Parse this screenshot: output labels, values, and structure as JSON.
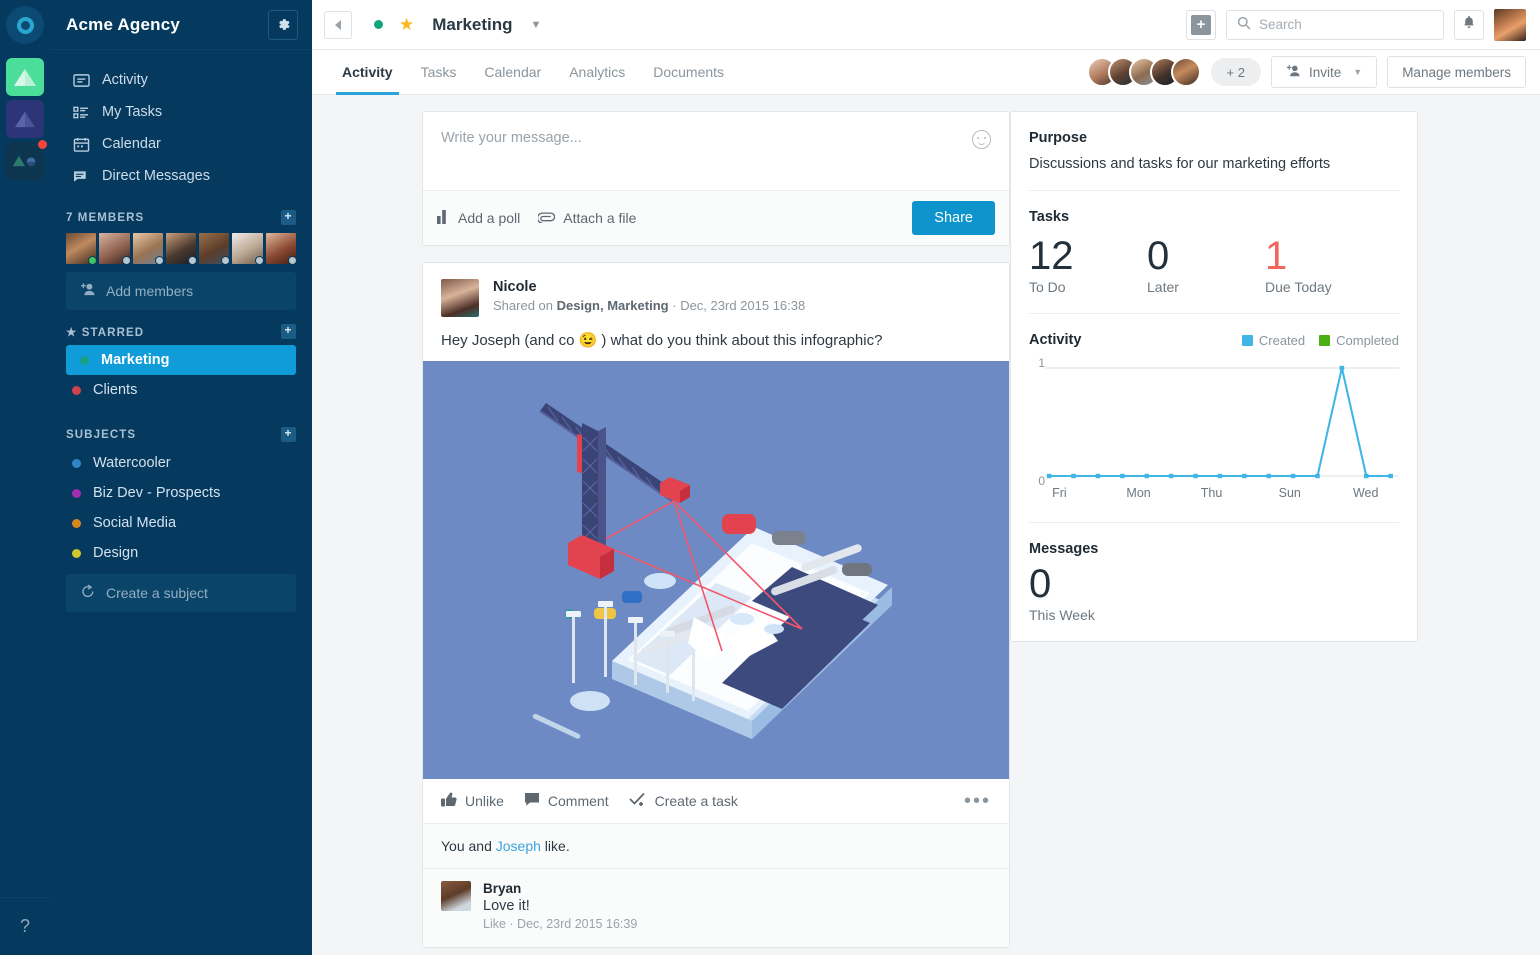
{
  "colors": {
    "sidebar_bg": "#05395e",
    "accent_blue": "#0f9cd8",
    "share_blue": "#0d94cd",
    "tab_underline": "#2aa3dd",
    "star_yellow": "#fcb71b",
    "due_red": "#f2665b",
    "created_blue": "#41b6e6",
    "completed_green": "#4caf12",
    "online_green": "#43c55e"
  },
  "rail": {
    "logo": "circle-logo",
    "apps": [
      {
        "name": "app-tile-green",
        "color": "#4ade9a"
      },
      {
        "name": "app-tile-indigo",
        "color": "#2e3478"
      },
      {
        "name": "app-tile-dark",
        "color": "#0d3550",
        "badge": true
      }
    ],
    "help_label": "?"
  },
  "sidebar": {
    "workspace_title": "Acme Agency",
    "settings_icon": "gear-icon",
    "nav": [
      {
        "label": "Activity",
        "icon": "activity-icon"
      },
      {
        "label": "My Tasks",
        "icon": "tasks-icon"
      },
      {
        "label": "Calendar",
        "icon": "calendar-icon"
      },
      {
        "label": "Direct Messages",
        "icon": "messages-icon"
      }
    ],
    "members_heading": "7 MEMBERS",
    "members_add_icon": "plus-icon",
    "member_count": 7,
    "members": [
      {
        "name": "member-avatar-1",
        "status": "online"
      },
      {
        "name": "member-avatar-2",
        "status": "offline"
      },
      {
        "name": "member-avatar-3",
        "status": "offline"
      },
      {
        "name": "member-avatar-4",
        "status": "offline"
      },
      {
        "name": "member-avatar-5",
        "status": "offline"
      },
      {
        "name": "member-avatar-6",
        "status": "offline"
      },
      {
        "name": "member-avatar-7",
        "status": "offline"
      }
    ],
    "add_members_label": "Add members",
    "starred_heading": "STARRED",
    "starred": [
      {
        "label": "Marketing",
        "color": "#16a085",
        "selected": true
      },
      {
        "label": "Clients",
        "color": "#d0434c",
        "selected": false
      }
    ],
    "subjects_heading": "SUBJECTS",
    "subjects": [
      {
        "label": "Watercooler",
        "color": "#2e86c8"
      },
      {
        "label": "Biz Dev - Prospects",
        "color": "#a12fb0"
      },
      {
        "label": "Social Media",
        "color": "#d9881c"
      },
      {
        "label": "Design",
        "color": "#cfc92c"
      }
    ],
    "create_subject_label": "Create a subject"
  },
  "topbar": {
    "back_icon": "chevron-left-icon",
    "channel_status_dot": "#12a47d",
    "star_icon": "star-icon",
    "channel_name": "Marketing",
    "channel_caret": "chevron-down-icon",
    "add_icon": "plus-icon",
    "search_placeholder": "Search",
    "search_value": "",
    "bell_icon": "bell-icon",
    "user_avatar": "current-user-avatar"
  },
  "tabs": [
    {
      "label": "Activity",
      "active": true
    },
    {
      "label": "Tasks",
      "active": false
    },
    {
      "label": "Calendar",
      "active": false
    },
    {
      "label": "Analytics",
      "active": false
    },
    {
      "label": "Documents",
      "active": false
    }
  ],
  "members_bar": {
    "overflow_label": "+ 2",
    "invite_label": "Invite",
    "invite_caret": "chevron-down-icon",
    "manage_label": "Manage members"
  },
  "composer": {
    "placeholder": "Write your message...",
    "value": "",
    "emoji_icon": "smiley-icon",
    "poll_label": "Add a poll",
    "poll_icon": "bar-chart-icon",
    "attach_label": "Attach a file",
    "attach_icon": "paperclip-icon",
    "share_label": "Share"
  },
  "post": {
    "author": "Nicole",
    "meta_prefix": "Shared on",
    "meta_channels": "Design, Marketing",
    "meta_sep": "·",
    "meta_date": "Dec, 23rd 2015 16:38",
    "body": "Hey Joseph (and co 😉 ) what do you think about this infographic?",
    "image_alt": "isometric-crane-smartphone-illustration",
    "actions": [
      {
        "label": "Unlike",
        "icon": "thumbs-up-icon"
      },
      {
        "label": "Comment",
        "icon": "comment-icon"
      },
      {
        "label": "Create a task",
        "icon": "check-task-icon"
      }
    ],
    "more_icon": "ellipsis-icon",
    "likes_prefix": "You  and ",
    "likes_link": "Joseph",
    "likes_suffix": " like.",
    "comments": [
      {
        "author": "Bryan",
        "body": "Love it!",
        "meta": "Like · Dec, 23rd 2015 16:39"
      }
    ]
  },
  "right_panel": {
    "purpose_heading": "Purpose",
    "purpose_text": "Discussions and tasks for our marketing efforts",
    "tasks_heading": "Tasks",
    "task_stats": [
      {
        "value": "12",
        "label": "To Do",
        "red": false
      },
      {
        "value": "0",
        "label": "Later",
        "red": false
      },
      {
        "value": "1",
        "label": "Due Today",
        "red": true
      }
    ],
    "activity_heading": "Activity",
    "legend": [
      {
        "label": "Created",
        "color": "#41b6e6"
      },
      {
        "label": "Completed",
        "color": "#4caf12"
      }
    ],
    "messages_heading": "Messages",
    "messages_value": "0",
    "messages_label": "This Week"
  },
  "chart_data": {
    "type": "line",
    "title": "Activity",
    "xlabel": "",
    "ylabel": "",
    "ylim": [
      0,
      1
    ],
    "ytick_labels": [
      "0",
      "1"
    ],
    "grid": true,
    "legend_position": "top-right",
    "x": [
      0,
      1,
      2,
      3,
      4,
      5,
      6,
      7,
      8,
      9,
      10,
      11,
      12,
      13
    ],
    "xtick_labels": [
      "Fri",
      "Mon",
      "Thu",
      "Sun",
      "Wed"
    ],
    "xtick_positions": [
      0,
      3,
      6,
      9,
      12
    ],
    "series": [
      {
        "name": "Created",
        "color": "#41b6e6",
        "values": [
          0,
          0,
          0,
          0,
          0,
          0,
          0,
          0,
          0,
          0,
          0,
          0,
          1,
          0,
          0
        ]
      },
      {
        "name": "Completed",
        "color": "#4caf12",
        "values": [
          0,
          0,
          0,
          0,
          0,
          0,
          0,
          0,
          0,
          0,
          0,
          0,
          0,
          0,
          0
        ]
      }
    ]
  }
}
